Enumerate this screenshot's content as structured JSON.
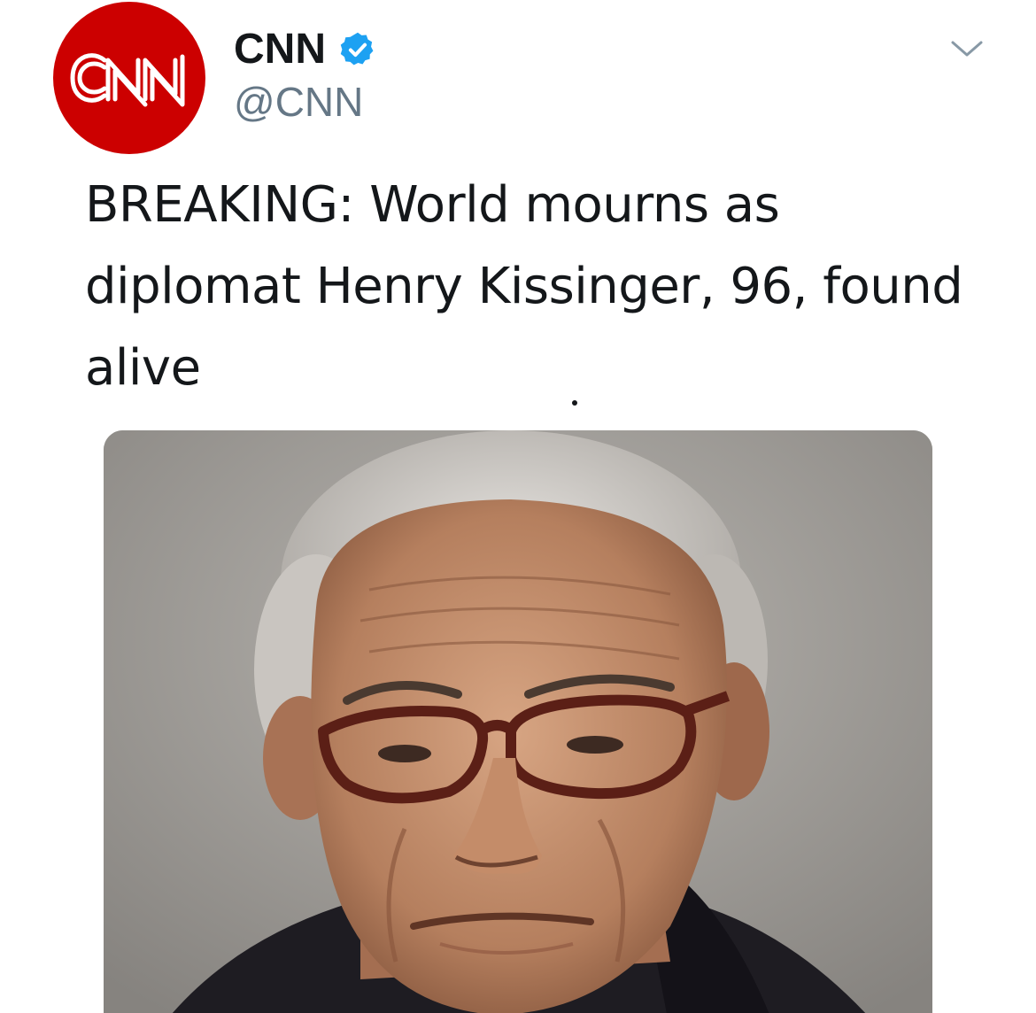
{
  "tweet": {
    "author": {
      "display_name": "CNN",
      "handle": "@CNN",
      "verified": true,
      "avatar_logo_text": "CNN",
      "avatar_color": "#cc0000"
    },
    "text": "BREAKING: World mourns as diplomat Henry Kissinger, 96, found alive",
    "media": {
      "type": "photo",
      "subject": "portrait of elderly man with glasses"
    }
  },
  "icons": {
    "verified": "verified-badge-icon",
    "more": "chevron-down-icon"
  },
  "colors": {
    "verified_blue": "#1da1f2",
    "text_primary": "#14171a",
    "text_secondary": "#657786",
    "brand_red": "#cc0000"
  }
}
